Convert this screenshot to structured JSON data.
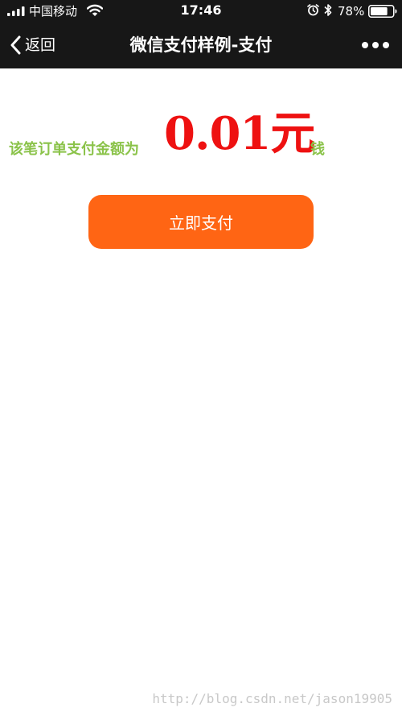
{
  "status_bar": {
    "carrier": "中国移动",
    "time": "17:46",
    "battery_percent": "78%",
    "battery_level": 0.78
  },
  "nav": {
    "back_label": "返回",
    "title": "微信支付样例-支付",
    "more_icon": "more-dots-icon"
  },
  "content": {
    "amount_prefix": "该笔订单支付金额为",
    "amount_value": "0.01元",
    "amount_suffix": "钱",
    "pay_button_label": "立即支付"
  },
  "watermark": "http://blog.csdn.net/jason19905",
  "colors": {
    "nav_background": "#171717",
    "amount_text": "#ee1111",
    "label_text": "#8bc34a",
    "button_background": "#ff6514",
    "page_background": "#ffffff"
  }
}
